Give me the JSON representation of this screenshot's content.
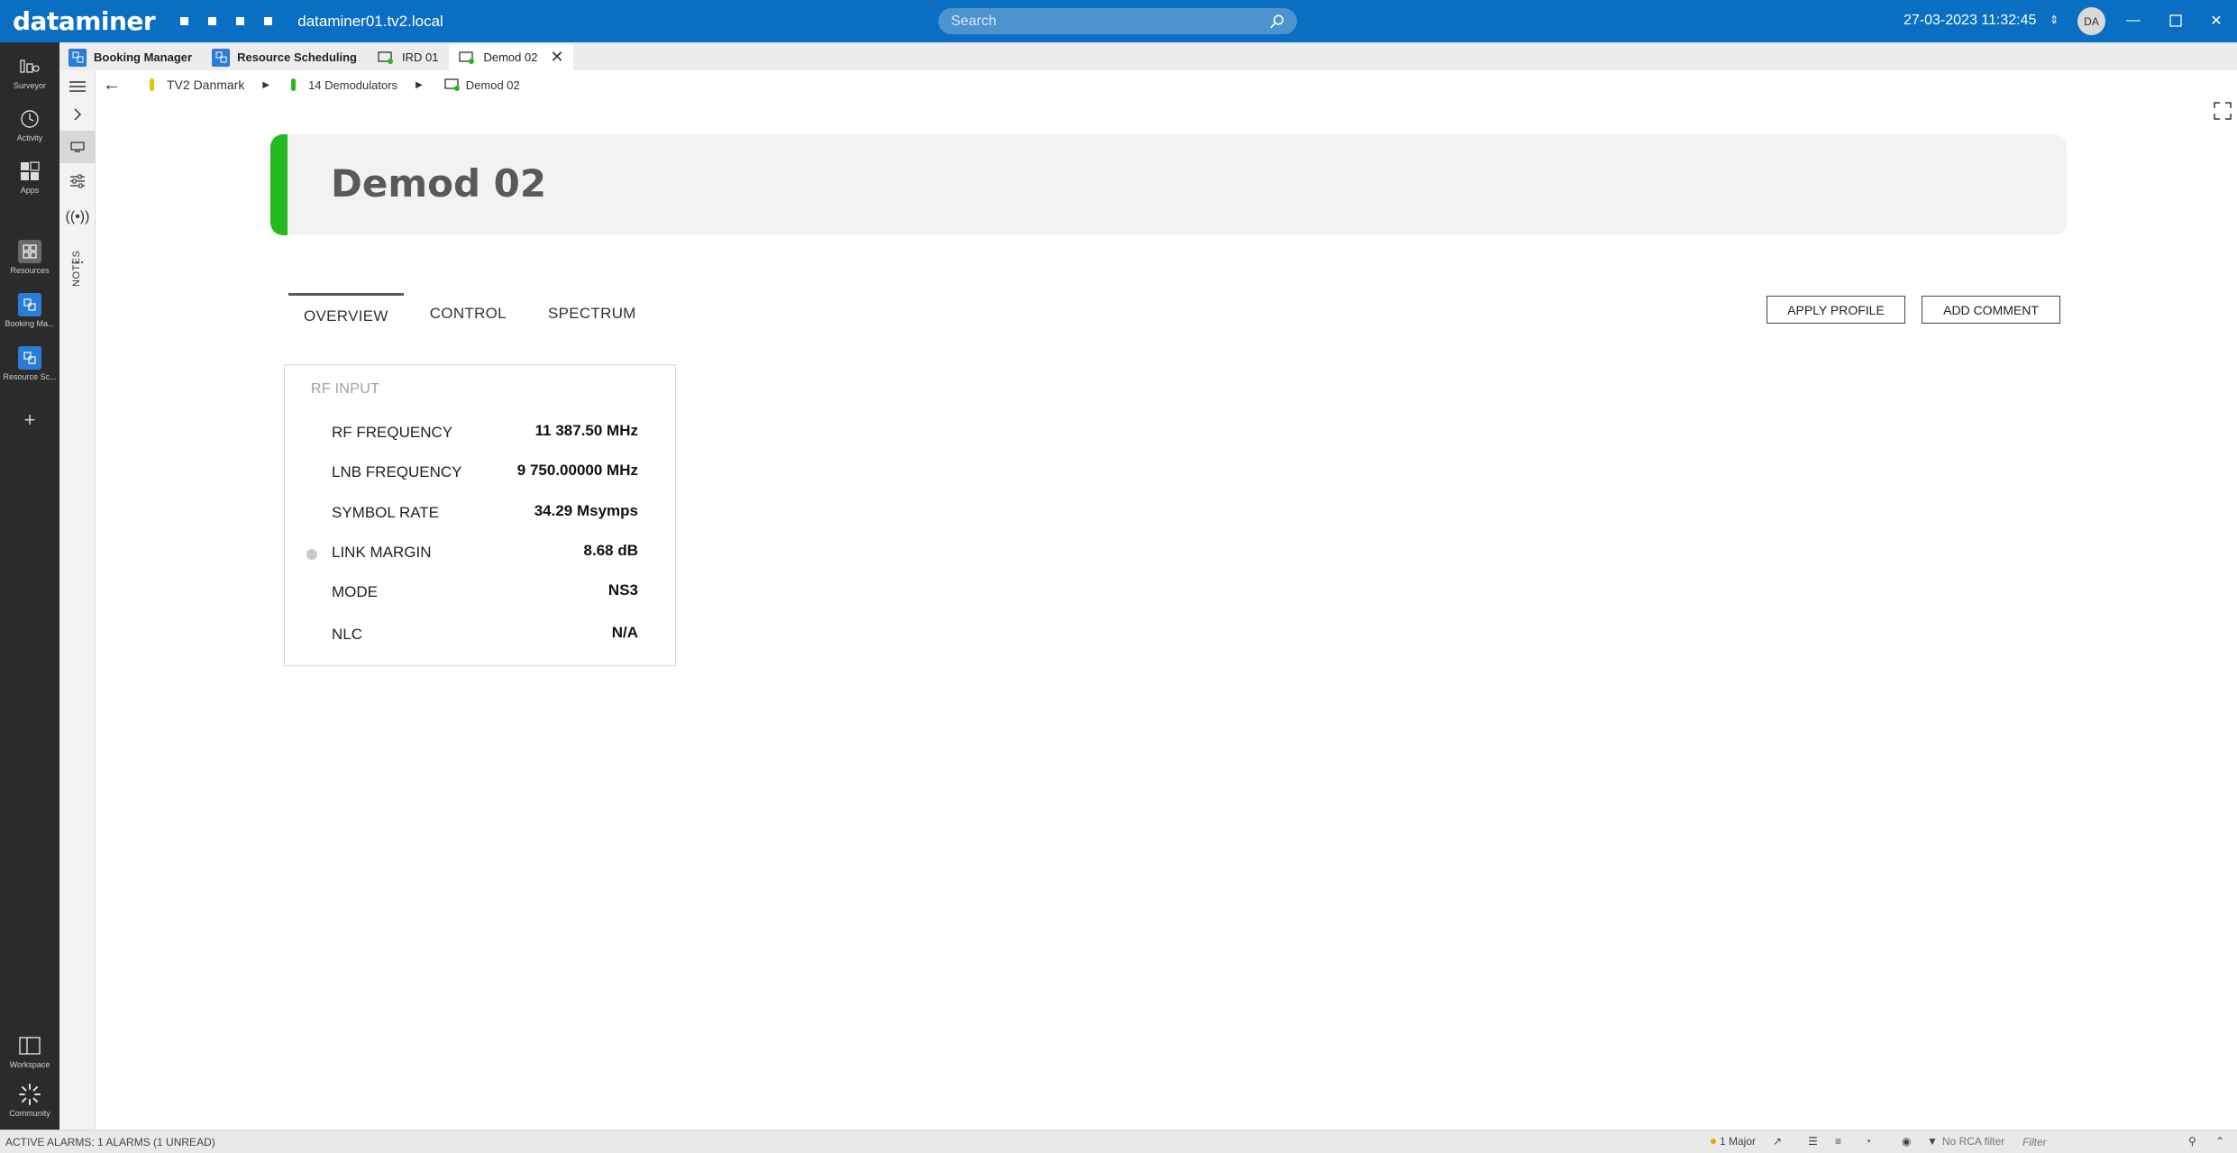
{
  "titlebar": {
    "logo": "dataminer",
    "hostname": "dataminer01.tv2.local",
    "search_placeholder": "Search",
    "datetime": "27-03-2023 11:32:45",
    "avatar_initials": "DA"
  },
  "rail": {
    "items": [
      {
        "label": "Surveyor",
        "icon": "surveyor-icon"
      },
      {
        "label": "Activity",
        "icon": "activity-icon"
      },
      {
        "label": "Apps",
        "icon": "apps-icon"
      },
      {
        "label": "Resources",
        "icon": "resources-icon"
      },
      {
        "label": "Booking Ma...",
        "icon": "booking-manager-icon"
      },
      {
        "label": "Resource Sc...",
        "icon": "resource-scheduling-icon"
      },
      {
        "label": "Workspace",
        "icon": "workspace-icon"
      },
      {
        "label": "Community",
        "icon": "community-icon"
      }
    ]
  },
  "tabs": [
    {
      "label": "Booking Manager",
      "icon": "booking-manager-icon"
    },
    {
      "label": "Resource Scheduling",
      "icon": "resource-scheduling-icon"
    },
    {
      "label": "IRD 01",
      "icon": "element-icon"
    },
    {
      "label": "Demod 02",
      "icon": "element-icon",
      "active": true
    }
  ],
  "sidecol": {
    "notes_label": "NOTES"
  },
  "breadcrumb": {
    "items": [
      {
        "label": "TV2 Danmark",
        "color": "#e8c300"
      },
      {
        "label": "14 Demodulators",
        "color": "#22b81e"
      },
      {
        "label": "Demod 02",
        "color": "#22b81e"
      }
    ]
  },
  "header": {
    "title": "Demod 02",
    "status_color": "#22b81e"
  },
  "page_tabs": [
    {
      "label": "OVERVIEW",
      "active": true
    },
    {
      "label": "CONTROL"
    },
    {
      "label": "SPECTRUM"
    }
  ],
  "actions": {
    "apply_profile": "APPLY PROFILE",
    "add_comment": "ADD COMMENT"
  },
  "rf_input": {
    "title": "RF INPUT",
    "rows": [
      {
        "label": "RF FREQUENCY",
        "value": "11 387.50 MHz"
      },
      {
        "label": "LNB FREQUENCY",
        "value": "9 750.00000 MHz"
      },
      {
        "label": "SYMBOL RATE",
        "value": "34.29 Msymps"
      },
      {
        "label": "LINK MARGIN",
        "value": "8.68 dB",
        "led": true
      },
      {
        "label": "MODE",
        "value": "NS3"
      },
      {
        "label": "NLC",
        "value": "N/A"
      }
    ]
  },
  "statusbar": {
    "active_alarms": "ACTIVE ALARMS: 1 ALARMS (1 UNREAD)",
    "major": "1 Major",
    "rca": "No RCA filter",
    "filter_placeholder": "Filter"
  },
  "colors": {
    "titlebar": "#0a6fc2",
    "rail": "#2b2b2b",
    "accent_blue": "#2a7cd4",
    "status_green": "#22b81e",
    "status_yellow": "#e8c300"
  }
}
